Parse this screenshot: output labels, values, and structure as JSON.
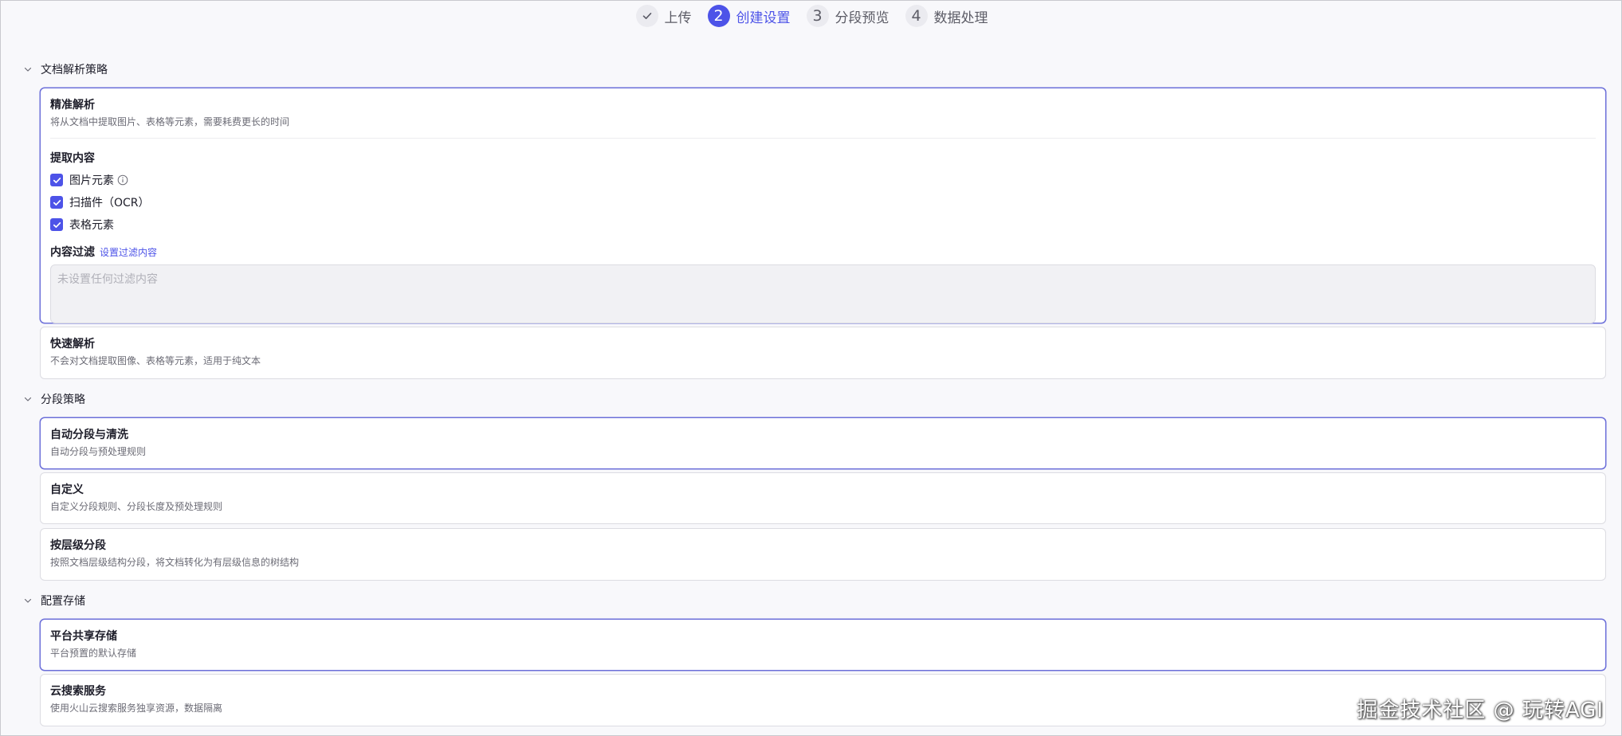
{
  "stepper": {
    "steps": [
      {
        "number": "",
        "label": "上传",
        "state": "done"
      },
      {
        "number": "2",
        "label": "创建设置",
        "state": "active"
      },
      {
        "number": "3",
        "label": "分段预览",
        "state": "todo"
      },
      {
        "number": "4",
        "label": "数据处理",
        "state": "todo"
      }
    ]
  },
  "parse": {
    "header": "文档解析策略",
    "precise": {
      "title": "精准解析",
      "desc": "将从文档中提取图片、表格等元素，需要耗费更长的时间",
      "extract_title": "提取内容",
      "options": [
        "图片元素",
        "扫描件（OCR）",
        "表格元素"
      ],
      "filter_title": "内容过滤",
      "filter_link": "设置过滤内容",
      "filter_placeholder": "未设置任何过滤内容"
    },
    "fast": {
      "title": "快速解析",
      "desc": "不会对文档提取图像、表格等元素，适用于纯文本"
    }
  },
  "segment": {
    "header": "分段策略",
    "options": [
      {
        "title": "自动分段与清洗",
        "desc": "自动分段与预处理规则"
      },
      {
        "title": "自定义",
        "desc": "自定义分段规则、分段长度及预处理规则"
      },
      {
        "title": "按层级分段",
        "desc": "按照文档层级结构分段，将文档转化为有层级信息的树结构"
      }
    ]
  },
  "storage": {
    "header": "配置存储",
    "options": [
      {
        "title": "平台共享存储",
        "desc": "平台预置的默认存储"
      },
      {
        "title": "云搜索服务",
        "desc": "使用火山云搜索服务独享资源，数据隔离"
      }
    ]
  },
  "watermark": "掘金技术社区 @ 玩转AGI",
  "colors": {
    "accent": "#4d53e8",
    "background": "#f8f8fb"
  }
}
